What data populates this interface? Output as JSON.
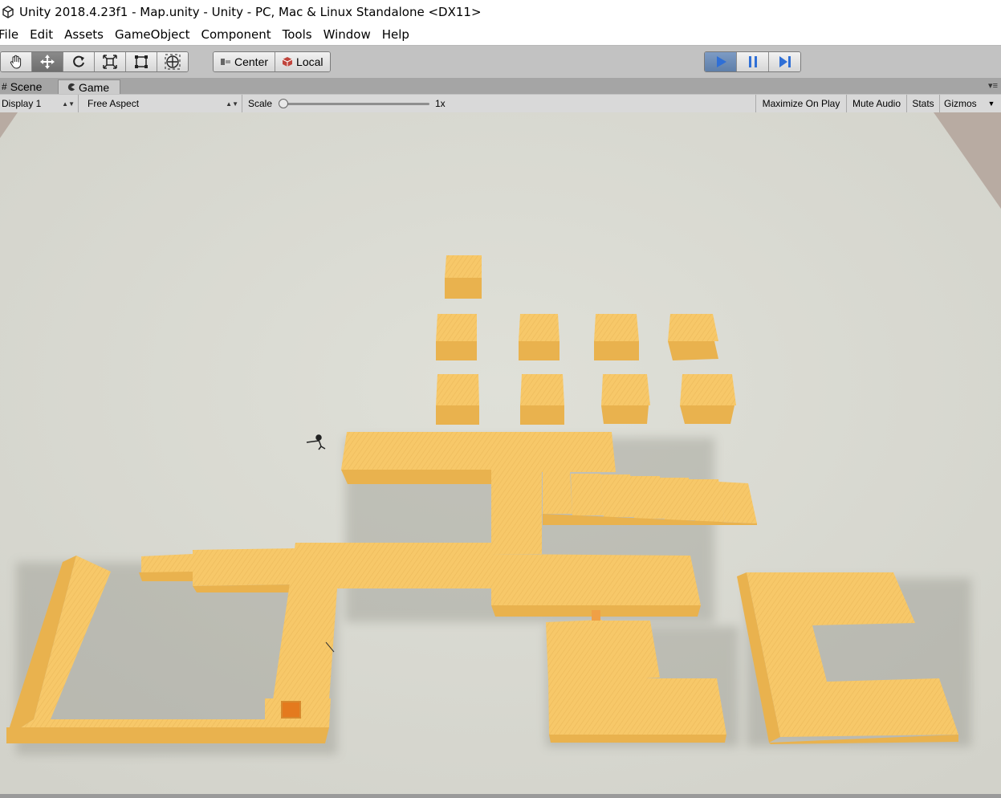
{
  "window": {
    "title": "Unity 2018.4.23f1 - Map.unity - Unity - PC, Mac & Linux Standalone <DX11>"
  },
  "menu": [
    "File",
    "Edit",
    "Assets",
    "GameObject",
    "Component",
    "Tools",
    "Window",
    "Help"
  ],
  "toolbar": {
    "transform_tools": [
      "hand-tool-icon",
      "move-tool-icon",
      "rotate-tool-icon",
      "scale-tool-icon",
      "rect-tool-icon",
      "transform-tool-icon"
    ],
    "active_tool": "move-tool-icon",
    "pivot_label": "Center",
    "space_label": "Local",
    "play_controls": [
      "play-icon",
      "pause-icon",
      "step-icon"
    ],
    "playing": true
  },
  "tabs": {
    "scene": "Scene",
    "game": "Game",
    "active": "Game"
  },
  "game_bar": {
    "display": "Display 1",
    "aspect": "Free Aspect",
    "scale_label": "Scale",
    "scale_value": "1x",
    "scale_fraction": 0.0,
    "maximize": "Maximize On Play",
    "mute": "Mute Audio",
    "stats": "Stats",
    "gizmos": "Gizmos"
  },
  "colors": {
    "floor": "#dcdcd4",
    "block_top": "#f7c869",
    "block_side": "#e9b24e",
    "play_active": "#2f6fd6"
  }
}
